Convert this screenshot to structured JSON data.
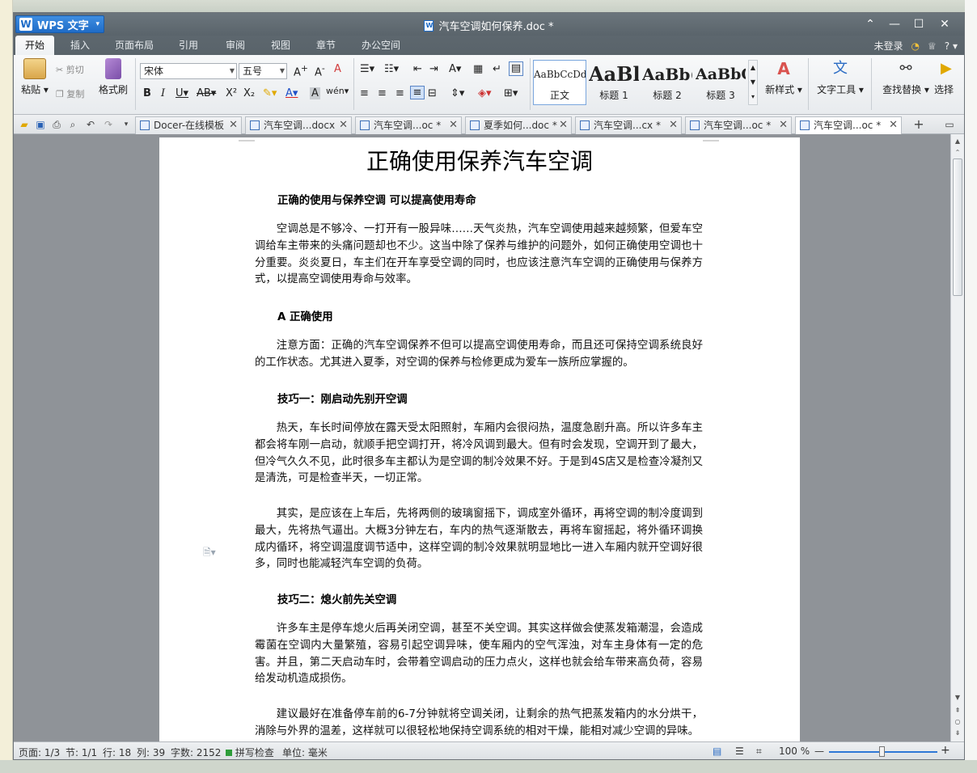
{
  "app": {
    "name": "WPS 文字",
    "logo_letter": "W"
  },
  "window": {
    "title": "汽车空调如何保养.doc *"
  },
  "ribbon_tabs": [
    "开始",
    "插入",
    "页面布局",
    "引用",
    "审阅",
    "视图",
    "章节",
    "办公空间"
  ],
  "ribbon_right": {
    "login": "未登录",
    "help": "?"
  },
  "ribbon": {
    "paste": "粘贴",
    "cut": "剪切",
    "copy": "复制",
    "format_painter": "格式刷",
    "font_name": "宋体",
    "font_size": "五号",
    "styles": [
      {
        "sample": "AaBbCcDd",
        "name": "正文"
      },
      {
        "sample": "AaBl",
        "name": "标题 1"
      },
      {
        "sample": "AaBb(",
        "name": "标题 2"
      },
      {
        "sample": "AaBbC",
        "name": "标题 3"
      }
    ],
    "new_style": "新样式",
    "text_tools": "文字工具",
    "find_replace": "查找替换",
    "select": "选择"
  },
  "doc_tabs": [
    {
      "label": "Docer-在线模板",
      "active": false
    },
    {
      "label": "汽车空调...docx",
      "active": false
    },
    {
      "label": "汽车空调...oc *",
      "active": false
    },
    {
      "label": "夏季如何...doc *",
      "active": false
    },
    {
      "label": "汽车空调...cx *",
      "active": false
    },
    {
      "label": "汽车空调...oc *",
      "active": false
    },
    {
      "label": "汽车空调...oc *",
      "active": true
    }
  ],
  "document": {
    "title": "正确使用保养汽车空调",
    "h1": "正确的使用与保养空调 可以提高使用寿命",
    "p1": "空调总是不够冷、一打开有一股异味……天气炎热，汽车空调使用越来越频繁，但爱车空调给车主带来的头痛问题却也不少。这当中除了保养与维护的问题外，如何正确使用空调也十分重要。炎炎夏日，车主们在开车享受空调的同时，也应该注意汽车空调的正确使用与保养方式，以提高空调使用寿命与效率。",
    "h2": "A 正确使用",
    "p2": "注意方面：正确的汽车空调保养不但可以提高空调使用寿命，而且还可保持空调系统良好的工作状态。尤其进入夏季，对空调的保养与检修更成为爱车一族所应掌握的。",
    "h3": "技巧一：刚启动先别开空调",
    "p3": "热天，车长时间停放在露天受太阳照射，车厢内会很闷热，温度急剧升高。所以许多车主都会将车刚一启动，就顺手把空调打开，将冷风调到最大。但有时会发现，空调开到了最大，但冷气久久不见，此时很多车主都认为是空调的制冷效果不好。于是到4S店又是检查冷凝剂又是清洗，可是检查半天，一切正常。",
    "p4": "其实，是应该在上车后，先将两侧的玻璃窗摇下，调成室外循环，再将空调的制冷度调到最大，先将热气逼出。大概3分钟左右，车内的热气逐渐散去，再将车窗摇起，将外循环调换成内循环，将空调温度调节适中，这样空调的制冷效果就明显地比一进入车厢内就开空调好很多，同时也能减轻汽车空调的负荷。",
    "h4": "技巧二：熄火前先关空调",
    "p5": "许多车主是停车熄火后再关闭空调，甚至不关空调。其实这样做会使蒸发箱潮湿，会造成霉菌在空调内大量繁殖，容易引起空调异味，使车厢内的空气浑浊，对车主身体有一定的危害。并且，第二天启动车时，会带着空调启动的压力点火，这样也就会给车带来高负荷，容易给发动机造成损伤。",
    "p6": "建议最好在准备停车前的6-7分钟就将空调关闭，让剩余的热气把蒸发箱内的水分烘干，消除与外界的温差，这样就可以很轻松地保持空调系统的相对干燥，能相对减少空调的异味。"
  },
  "status": {
    "page": "页面: 1/3",
    "section": "节: 1/1",
    "row": "行: 18",
    "col": "列: 39",
    "words": "字数: 2152",
    "spell": "拼写检查",
    "unit": "单位: 毫米",
    "zoom": "100 %"
  },
  "colors": {
    "accent": "#1f6cc7",
    "titlebar": "#5f696f"
  }
}
